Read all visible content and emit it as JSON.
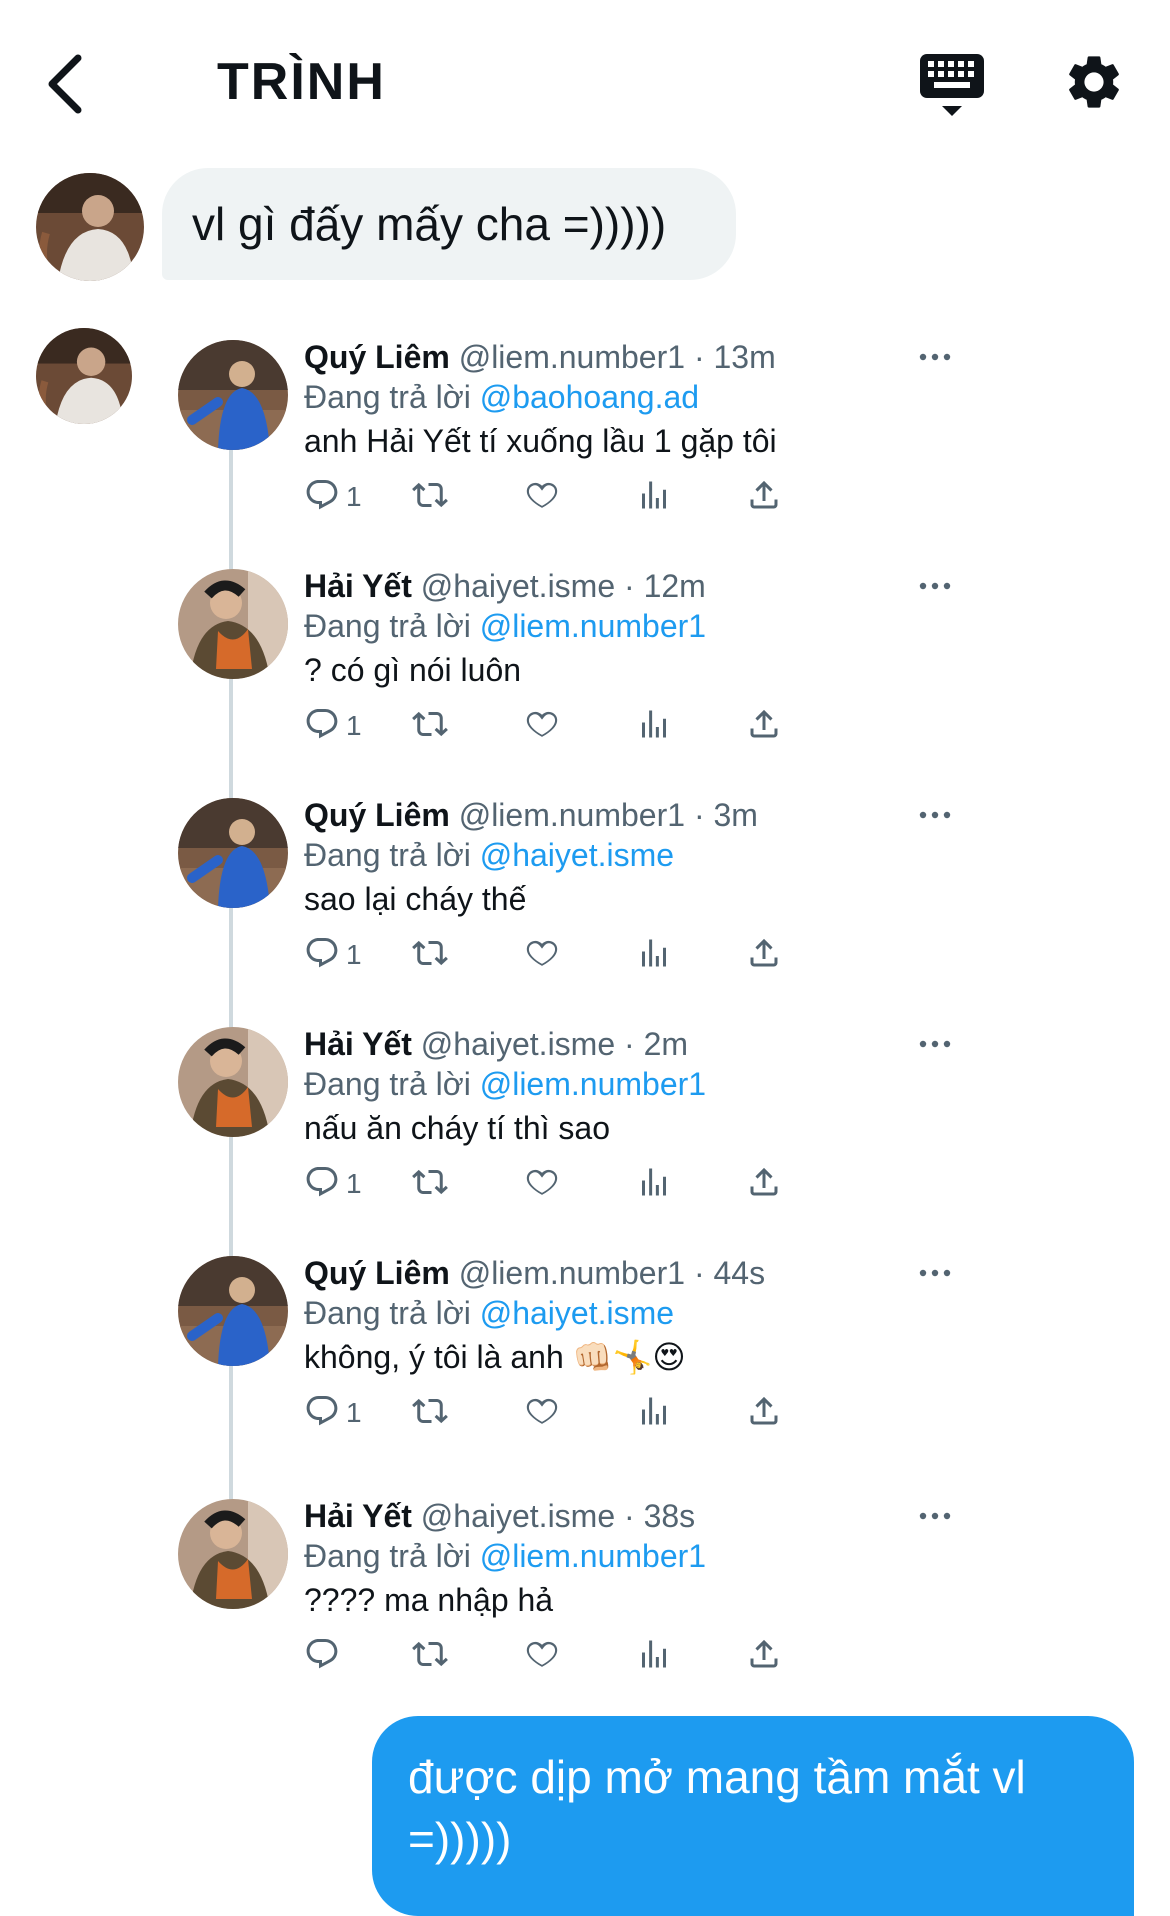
{
  "header": {
    "title": "TRÌNH",
    "back_icon": "chevron-left-icon",
    "keyboard_icon": "keyboard-icon",
    "settings_icon": "gear-icon"
  },
  "messages": {
    "incoming": "vl gì đấy mấy cha =)))))",
    "outgoing": "được dịp mở mang tầm mắt vl =)))))"
  },
  "tweets": [
    {
      "name": "Quý Liêm",
      "handle": "@liem.number1",
      "sep": " · ",
      "time": "13m",
      "reply_prefix": "Đang trả lời ",
      "reply_to": "@baohoang.ad",
      "text": "anh Hải Yết tí xuống lầu 1 gặp tôi",
      "replies": "1"
    },
    {
      "name": "Hải Yết",
      "handle": "@haiyet.isme",
      "sep": " · ",
      "time": "12m",
      "reply_prefix": "Đang trả lời ",
      "reply_to": "@liem.number1",
      "text": "? có gì nói luôn",
      "replies": "1"
    },
    {
      "name": "Quý Liêm",
      "handle": "@liem.number1",
      "sep": " · ",
      "time": "3m",
      "reply_prefix": "Đang trả lời ",
      "reply_to": "@haiyet.isme",
      "text": "sao lại cháy thế",
      "replies": "1"
    },
    {
      "name": "Hải Yết",
      "handle": "@haiyet.isme",
      "sep": " · ",
      "time": "2m",
      "reply_prefix": "Đang trả lời ",
      "reply_to": "@liem.number1",
      "text": "nấu ăn cháy tí thì sao",
      "replies": "1"
    },
    {
      "name": "Quý Liêm",
      "handle": "@liem.number1",
      "sep": " · ",
      "time": "44s",
      "reply_prefix": "Đang trả lời ",
      "reply_to": "@haiyet.isme",
      "text": "không, ý tôi là anh 👊🏻🤸😍",
      "replies": "1"
    },
    {
      "name": "Hải Yết",
      "handle": "@haiyet.isme",
      "sep": " · ",
      "time": "38s",
      "reply_prefix": "Đang trả lời ",
      "reply_to": "@liem.number1",
      "text": "???? ma nhập hả",
      "replies": ""
    }
  ],
  "colors": {
    "accent": "#1d9bf0",
    "bubble_gray": "#eff3f4",
    "secondary_text": "#536471"
  }
}
